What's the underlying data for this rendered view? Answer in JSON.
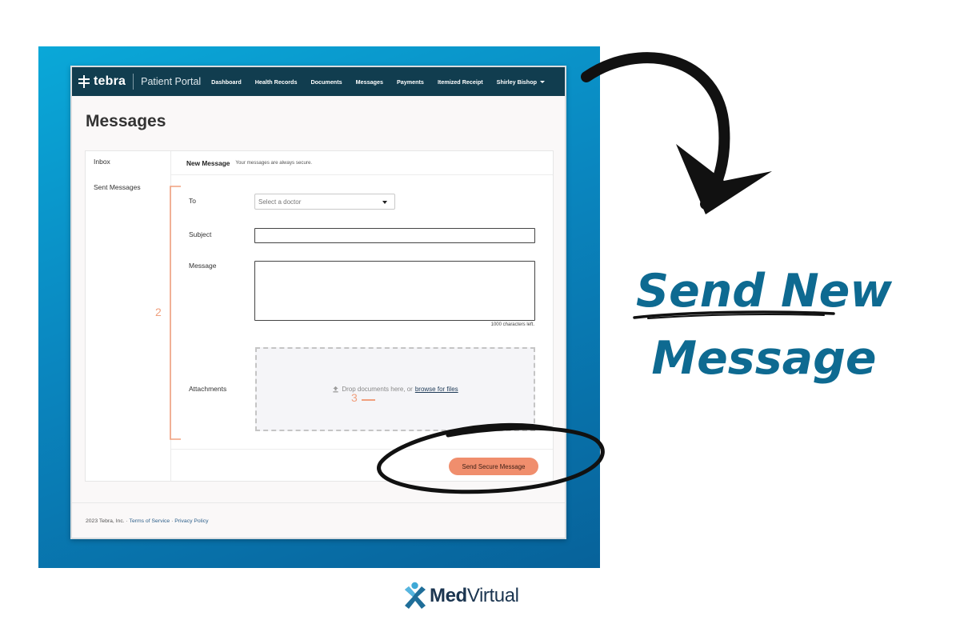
{
  "portal": {
    "brand": "tebra",
    "product": "Patient Portal",
    "nav": [
      "Dashboard",
      "Health Records",
      "Documents",
      "Messages",
      "Payments",
      "Itemized Receipt"
    ],
    "user": "Shirley Bishop",
    "page_title": "Messages",
    "sidebar": {
      "inbox": "Inbox",
      "sent": "Sent Messages"
    },
    "compose": {
      "title": "New Message",
      "note": "Your messages are always secure.",
      "to_label": "To",
      "to_placeholder": "Select a doctor",
      "subject_label": "Subject",
      "subject_value": "",
      "message_label": "Message",
      "message_value": "",
      "chars_left": "1000 characters left.",
      "attachments_label": "Attachments",
      "dropzone_text": "Drop documents here, or",
      "browse_link": "browse for files",
      "send_button": "Send Secure Message"
    },
    "footer": {
      "copyright": "2023 Tebra, Inc.",
      "terms": "Terms of Service",
      "privacy": "Privacy Policy",
      "separator": "·"
    }
  },
  "annotations": {
    "step_2": "2",
    "step_3": "3"
  },
  "headline": {
    "line1": "Send New",
    "line2": "Message"
  },
  "logo": {
    "part1": "Med",
    "part2": "Virtual"
  },
  "colors": {
    "nav_bg": "#113d4f",
    "accent_orange": "#f08e6d",
    "headline_blue": "#0e6a91",
    "backdrop_blue": "#0a86bf"
  },
  "icons": [
    "tebra-logo-icon",
    "caret-down-icon",
    "upload-icon",
    "curved-arrow",
    "medvirtual-logo-icon"
  ]
}
